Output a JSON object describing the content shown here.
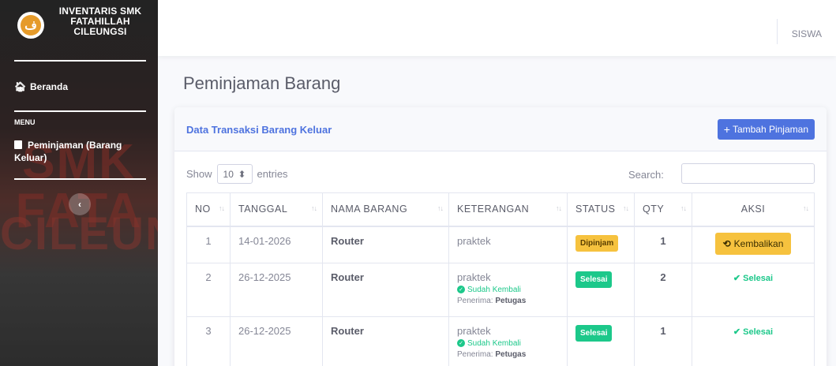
{
  "sidebar": {
    "brand": "INVENTARIS SMK FATAHILLAH CILEUNGSI",
    "nav_home": "Beranda",
    "menu_heading": "MENU",
    "nav_pinjam": "Peminjaman (Barang Keluar)",
    "bg_text_1": "SMK FATA",
    "bg_text_2": "CILEUN",
    "toggle_icon": "chevron-left-icon"
  },
  "topbar": {
    "user": "SISWA"
  },
  "page": {
    "title": "Peminjaman Barang"
  },
  "card": {
    "title": "Data Transaksi Barang Keluar",
    "add_button": "Tambah Pinjaman"
  },
  "table_controls": {
    "show_label": "Show",
    "entries_value": "10",
    "entries_label": "entries",
    "search_label": "Search:"
  },
  "table": {
    "headers": [
      "NO",
      "TANGGAL",
      "NAMA BARANG",
      "KETERANGAN",
      "STATUS",
      "QTY",
      "AKSI"
    ],
    "rows": [
      {
        "no": "1",
        "tanggal": "14-01-2026",
        "nama": "Router",
        "keterangan": "praktek",
        "sub_status": "",
        "penerima_label": "",
        "penerima": "",
        "status": "Dipinjam",
        "qty": "1",
        "aksi": "Kembalikan"
      },
      {
        "no": "2",
        "tanggal": "26-12-2025",
        "nama": "Router",
        "keterangan": "praktek",
        "sub_status": "Sudah Kembali",
        "penerima_label": "Penerima:",
        "penerima": "Petugas",
        "status": "Selesai",
        "qty": "2",
        "aksi": "Selesai"
      },
      {
        "no": "3",
        "tanggal": "26-12-2025",
        "nama": "Router",
        "keterangan": "praktek",
        "sub_status": "Sudah Kembali",
        "penerima_label": "Penerima:",
        "penerima": "Petugas",
        "status": "Selesai",
        "qty": "1",
        "aksi": "Selesai"
      }
    ]
  },
  "colors": {
    "primary": "#4e73df",
    "warning": "#f6c23e",
    "success": "#1cc88a"
  }
}
